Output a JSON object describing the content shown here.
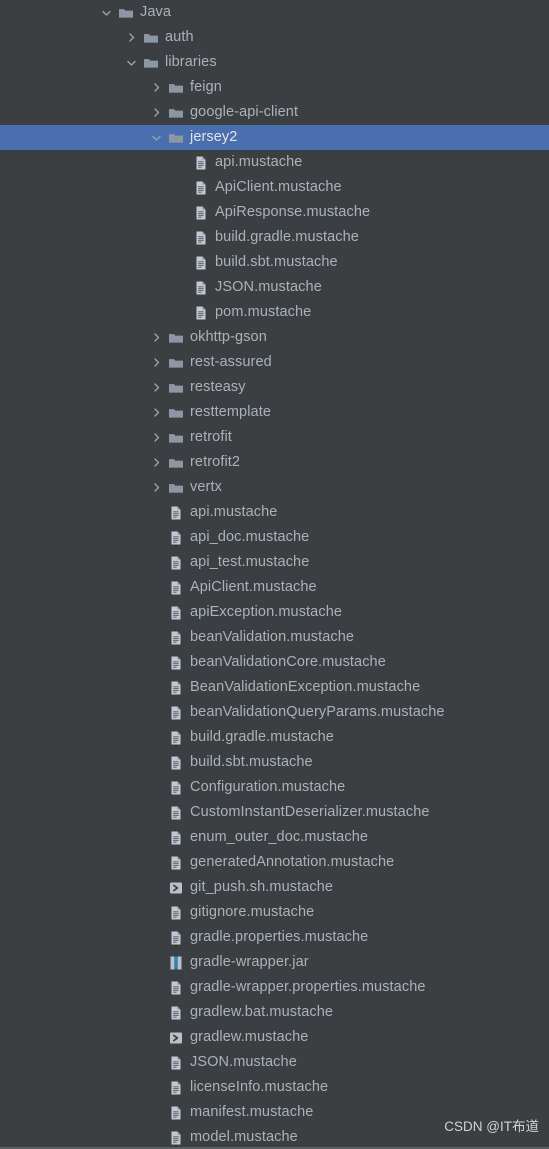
{
  "theme": {
    "background": "#3c3f41",
    "text": "#a9b2bc",
    "selected_background": "#4b6eaf",
    "selected_text": "#dfe4ea",
    "folder_icon_color": "#8d97a3",
    "file_icon_color": "#9aa3ad",
    "jar_accent_color": "#3592c4",
    "bottom_border": "#5a5f61"
  },
  "watermark": "CSDN @IT布道",
  "tree": {
    "rows": [
      {
        "label": "Java",
        "icon": "folder-icon",
        "twisty": "chevron-down-icon",
        "indent": 0,
        "selected": false
      },
      {
        "label": "auth",
        "icon": "folder-icon",
        "twisty": "chevron-right-icon",
        "indent": 1,
        "selected": false
      },
      {
        "label": "libraries",
        "icon": "folder-icon",
        "twisty": "chevron-down-icon",
        "indent": 1,
        "selected": false
      },
      {
        "label": "feign",
        "icon": "folder-icon",
        "twisty": "chevron-right-icon",
        "indent": 2,
        "selected": false
      },
      {
        "label": "google-api-client",
        "icon": "folder-icon",
        "twisty": "chevron-right-icon",
        "indent": 2,
        "selected": false
      },
      {
        "label": "jersey2",
        "icon": "folder-icon",
        "twisty": "chevron-down-icon",
        "indent": 2,
        "selected": true
      },
      {
        "label": "api.mustache",
        "icon": "mustache-file-icon",
        "twisty": "none",
        "indent": 3,
        "selected": false
      },
      {
        "label": "ApiClient.mustache",
        "icon": "mustache-file-icon",
        "twisty": "none",
        "indent": 3,
        "selected": false
      },
      {
        "label": "ApiResponse.mustache",
        "icon": "mustache-file-icon",
        "twisty": "none",
        "indent": 3,
        "selected": false
      },
      {
        "label": "build.gradle.mustache",
        "icon": "mustache-file-icon",
        "twisty": "none",
        "indent": 3,
        "selected": false
      },
      {
        "label": "build.sbt.mustache",
        "icon": "mustache-file-icon",
        "twisty": "none",
        "indent": 3,
        "selected": false
      },
      {
        "label": "JSON.mustache",
        "icon": "mustache-file-icon",
        "twisty": "none",
        "indent": 3,
        "selected": false
      },
      {
        "label": "pom.mustache",
        "icon": "mustache-file-icon",
        "twisty": "none",
        "indent": 3,
        "selected": false
      },
      {
        "label": "okhttp-gson",
        "icon": "folder-icon",
        "twisty": "chevron-right-icon",
        "indent": 2,
        "selected": false
      },
      {
        "label": "rest-assured",
        "icon": "folder-icon",
        "twisty": "chevron-right-icon",
        "indent": 2,
        "selected": false
      },
      {
        "label": "resteasy",
        "icon": "folder-icon",
        "twisty": "chevron-right-icon",
        "indent": 2,
        "selected": false
      },
      {
        "label": "resttemplate",
        "icon": "folder-icon",
        "twisty": "chevron-right-icon",
        "indent": 2,
        "selected": false
      },
      {
        "label": "retrofit",
        "icon": "folder-icon",
        "twisty": "chevron-right-icon",
        "indent": 2,
        "selected": false
      },
      {
        "label": "retrofit2",
        "icon": "folder-icon",
        "twisty": "chevron-right-icon",
        "indent": 2,
        "selected": false
      },
      {
        "label": "vertx",
        "icon": "folder-icon",
        "twisty": "chevron-right-icon",
        "indent": 2,
        "selected": false
      },
      {
        "label": "api.mustache",
        "icon": "mustache-file-icon",
        "twisty": "none",
        "indent": 2,
        "selected": false
      },
      {
        "label": "api_doc.mustache",
        "icon": "mustache-file-icon",
        "twisty": "none",
        "indent": 2,
        "selected": false
      },
      {
        "label": "api_test.mustache",
        "icon": "mustache-file-icon",
        "twisty": "none",
        "indent": 2,
        "selected": false
      },
      {
        "label": "ApiClient.mustache",
        "icon": "mustache-file-icon",
        "twisty": "none",
        "indent": 2,
        "selected": false
      },
      {
        "label": "apiException.mustache",
        "icon": "mustache-file-icon",
        "twisty": "none",
        "indent": 2,
        "selected": false
      },
      {
        "label": "beanValidation.mustache",
        "icon": "mustache-file-icon",
        "twisty": "none",
        "indent": 2,
        "selected": false
      },
      {
        "label": "beanValidationCore.mustache",
        "icon": "mustache-file-icon",
        "twisty": "none",
        "indent": 2,
        "selected": false
      },
      {
        "label": "BeanValidationException.mustache",
        "icon": "mustache-file-icon",
        "twisty": "none",
        "indent": 2,
        "selected": false
      },
      {
        "label": "beanValidationQueryParams.mustache",
        "icon": "mustache-file-icon",
        "twisty": "none",
        "indent": 2,
        "selected": false
      },
      {
        "label": "build.gradle.mustache",
        "icon": "mustache-file-icon",
        "twisty": "none",
        "indent": 2,
        "selected": false
      },
      {
        "label": "build.sbt.mustache",
        "icon": "mustache-file-icon",
        "twisty": "none",
        "indent": 2,
        "selected": false
      },
      {
        "label": "Configuration.mustache",
        "icon": "mustache-file-icon",
        "twisty": "none",
        "indent": 2,
        "selected": false
      },
      {
        "label": "CustomInstantDeserializer.mustache",
        "icon": "mustache-file-icon",
        "twisty": "none",
        "indent": 2,
        "selected": false
      },
      {
        "label": "enum_outer_doc.mustache",
        "icon": "mustache-file-icon",
        "twisty": "none",
        "indent": 2,
        "selected": false
      },
      {
        "label": "generatedAnnotation.mustache",
        "icon": "mustache-file-icon",
        "twisty": "none",
        "indent": 2,
        "selected": false
      },
      {
        "label": "git_push.sh.mustache",
        "icon": "shell-script-icon",
        "twisty": "none",
        "indent": 2,
        "selected": false
      },
      {
        "label": "gitignore.mustache",
        "icon": "mustache-file-icon",
        "twisty": "none",
        "indent": 2,
        "selected": false
      },
      {
        "label": "gradle.properties.mustache",
        "icon": "mustache-file-icon",
        "twisty": "none",
        "indent": 2,
        "selected": false
      },
      {
        "label": "gradle-wrapper.jar",
        "icon": "jar-archive-icon",
        "twisty": "none",
        "indent": 2,
        "selected": false
      },
      {
        "label": "gradle-wrapper.properties.mustache",
        "icon": "mustache-file-icon",
        "twisty": "none",
        "indent": 2,
        "selected": false
      },
      {
        "label": "gradlew.bat.mustache",
        "icon": "mustache-file-icon",
        "twisty": "none",
        "indent": 2,
        "selected": false
      },
      {
        "label": "gradlew.mustache",
        "icon": "shell-script-icon",
        "twisty": "none",
        "indent": 2,
        "selected": false
      },
      {
        "label": "JSON.mustache",
        "icon": "mustache-file-icon",
        "twisty": "none",
        "indent": 2,
        "selected": false
      },
      {
        "label": "licenseInfo.mustache",
        "icon": "mustache-file-icon",
        "twisty": "none",
        "indent": 2,
        "selected": false
      },
      {
        "label": "manifest.mustache",
        "icon": "mustache-file-icon",
        "twisty": "none",
        "indent": 2,
        "selected": false
      },
      {
        "label": "model.mustache",
        "icon": "mustache-file-icon",
        "twisty": "none",
        "indent": 2,
        "selected": false
      }
    ]
  }
}
